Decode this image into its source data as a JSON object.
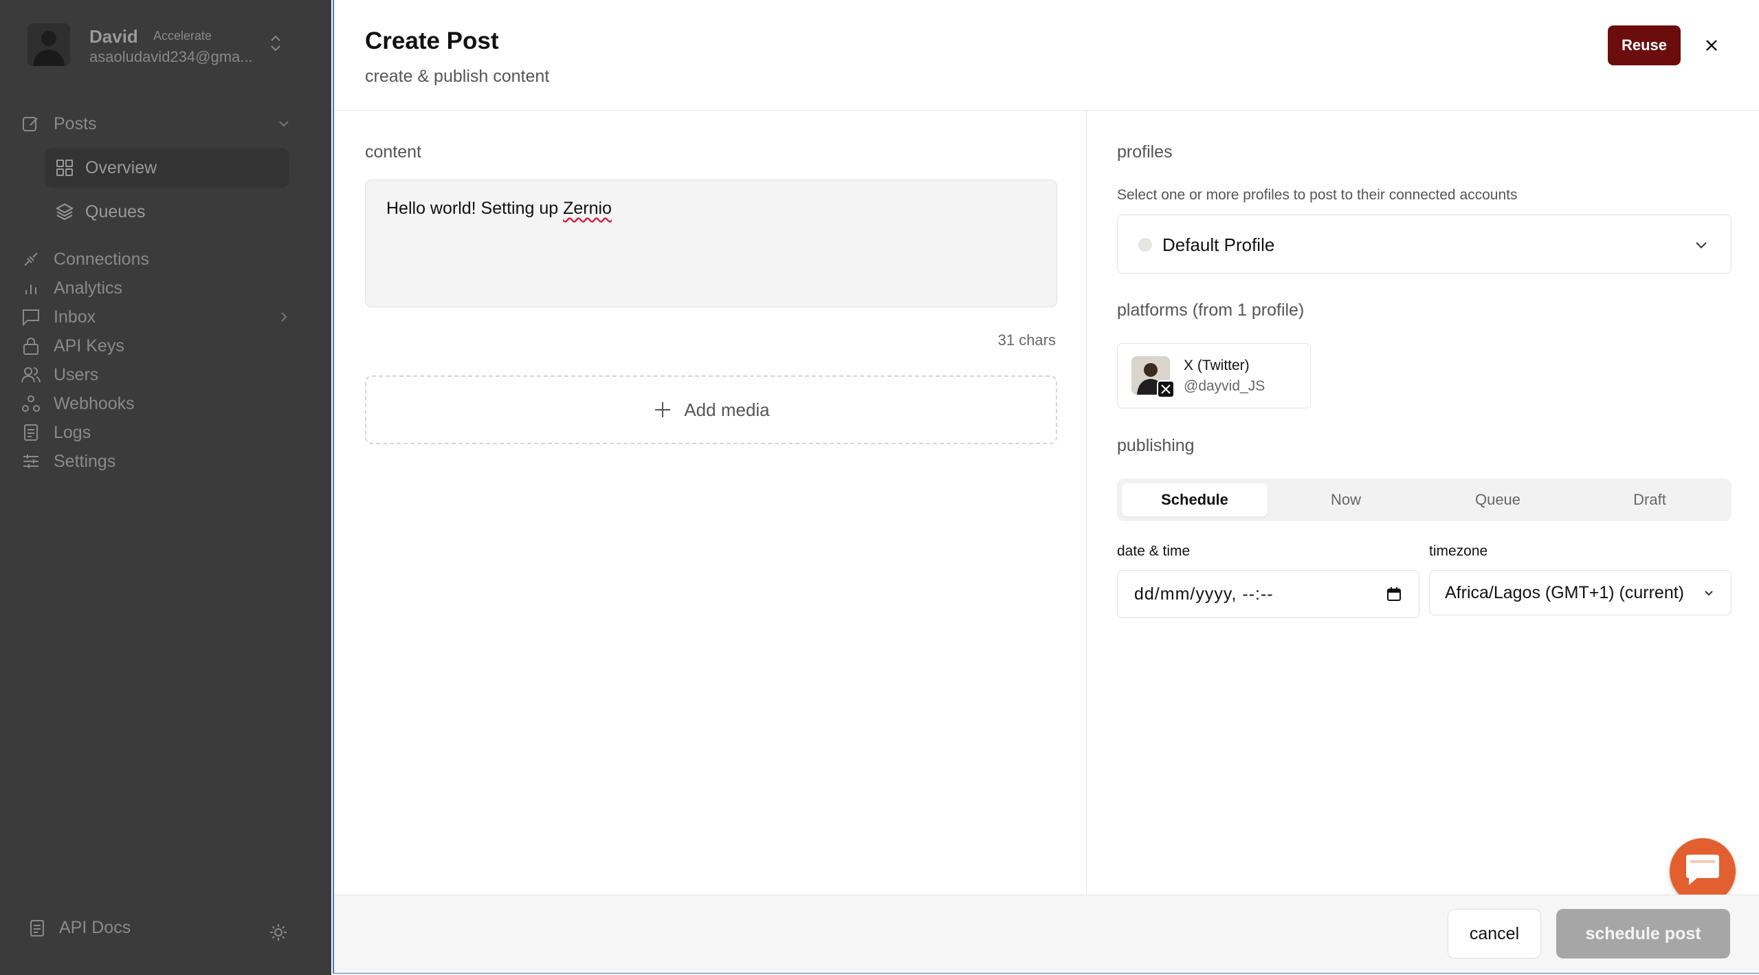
{
  "sidebar": {
    "user": {
      "name": "David",
      "plan": "Accelerate",
      "email": "asaoludavid234@gma..."
    },
    "nav": {
      "posts": "Posts",
      "overview": "Overview",
      "queues": "Queues",
      "connections": "Connections",
      "analytics": "Analytics",
      "inbox": "Inbox",
      "api_keys": "API Keys",
      "users": "Users",
      "webhooks": "Webhooks",
      "logs": "Logs",
      "settings": "Settings"
    },
    "api_docs": "API Docs"
  },
  "dialog": {
    "title": "Create Post",
    "subtitle": "create & publish content",
    "reuse_label": "Reuse",
    "content": {
      "label": "content",
      "text_plain": "Hello world! Setting up ",
      "text_flagged": "Zernio",
      "char_count": "31 chars",
      "add_media": "Add media"
    },
    "profiles": {
      "label": "profiles",
      "hint": "Select one or more profiles to post to their connected accounts",
      "selected": "Default Profile"
    },
    "platforms": {
      "label": "platforms (from 1 profile)",
      "items": [
        {
          "name": "X (Twitter)",
          "handle": "@dayvid_JS"
        }
      ]
    },
    "publishing": {
      "label": "publishing",
      "tabs": [
        "Schedule",
        "Now",
        "Queue",
        "Draft"
      ],
      "active_tab": "Schedule",
      "date_label": "date & time",
      "date_placeholder": "dd/mm/yyyy, --:--",
      "timezone_label": "timezone",
      "timezone_value": "Africa/Lagos (GMT+1) (current)"
    },
    "footer": {
      "cancel_label": "cancel",
      "schedule_label": "schedule post"
    }
  },
  "colors": {
    "reuse_bg": "#6b0d0d",
    "chat_fab": "#e2602f",
    "sidebar_bg": "#3b3b3b",
    "schedule_disabled": "#a6a6a6"
  }
}
